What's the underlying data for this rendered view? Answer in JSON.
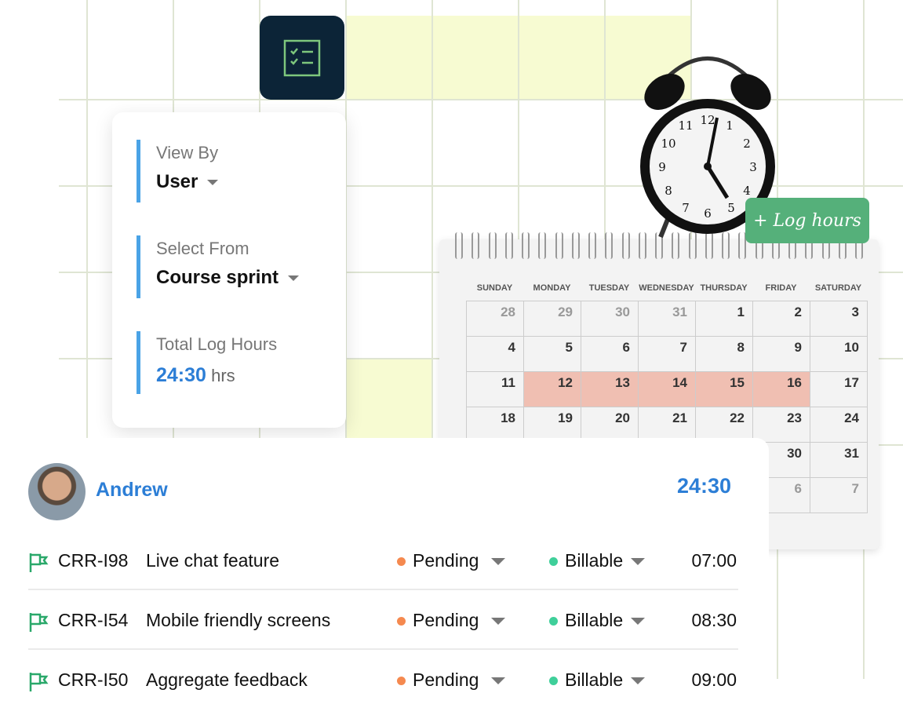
{
  "filters": [
    {
      "label": "View By",
      "value": "User"
    },
    {
      "label": "Select From",
      "value": "Course sprint"
    }
  ],
  "total_log": {
    "label": "Total Log Hours",
    "value": "24:30",
    "unit": "hrs"
  },
  "log_hours_button": "+ Log hours",
  "calendar": {
    "days": [
      "SUNDAY",
      "MONDAY",
      "TUESDAY",
      "WEDNESDAY",
      "THURSDAY",
      "FRIDAY",
      "SATURDAY"
    ],
    "weeks": [
      [
        "28",
        "29",
        "30",
        "31",
        "1",
        "2",
        "3"
      ],
      [
        "4",
        "5",
        "6",
        "7",
        "8",
        "9",
        "10"
      ],
      [
        "11",
        "12",
        "13",
        "14",
        "15",
        "16",
        "17"
      ],
      [
        "18",
        "19",
        "20",
        "21",
        "22",
        "23",
        "24"
      ],
      [
        "",
        "",
        "",
        "",
        "",
        "30",
        "31"
      ],
      [
        "",
        "",
        "",
        "",
        "",
        "6",
        "7"
      ]
    ],
    "highlighted": [
      "12",
      "13",
      "14",
      "15",
      "16"
    ],
    "highlight_color": "#f0bfb2"
  },
  "user": {
    "name": "Andrew",
    "total": "24:30"
  },
  "tasks": [
    {
      "id": "CRR-I98",
      "title": "Live chat feature",
      "status": "Pending",
      "billing": "Billable",
      "time": "07:00"
    },
    {
      "id": "CRR-I54",
      "title": "Mobile friendly screens",
      "status": "Pending",
      "billing": "Billable",
      "time": "08:30"
    },
    {
      "id": "CRR-I50",
      "title": "Aggregate feedback",
      "status": "Pending",
      "billing": "Billable",
      "time": "09:00"
    }
  ],
  "colors": {
    "accent": "#2c7ed6",
    "pending": "#f5894f",
    "billable": "#3fcf9a",
    "flag": "#2aa86a",
    "log_button": "#55b07a"
  }
}
